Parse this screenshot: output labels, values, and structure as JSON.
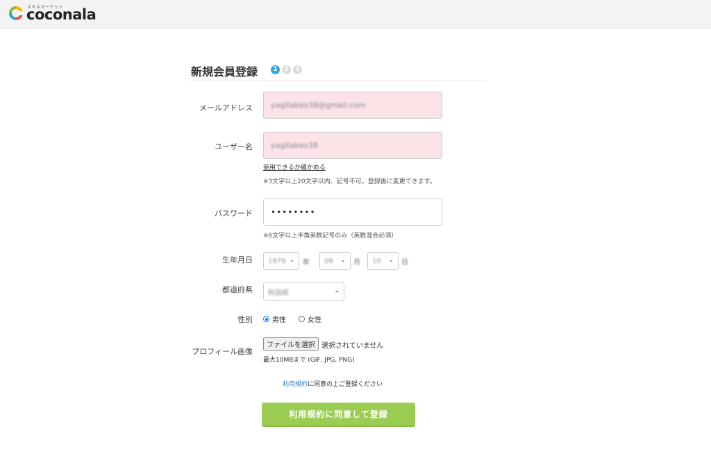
{
  "header": {
    "logo_tagline": "スキルマーケット",
    "logo_text": "coconala"
  },
  "form": {
    "title": "新規会員登録",
    "steps": [
      "1",
      "2",
      "3"
    ],
    "email": {
      "label": "メールアドレス",
      "value": "yagitakeo38@gmail.com"
    },
    "username": {
      "label": "ユーザー名",
      "value": "yagitakeo38",
      "check_link": "使用できるか確かめる",
      "note": "※3文字以上20文字以内、記号不可。登録後に変更できます。"
    },
    "password": {
      "label": "パスワード",
      "value": "••••••••",
      "note": "※6文字以上半角英数記号のみ（英数混合必須）"
    },
    "birthday": {
      "label": "生年月日",
      "year": "1979",
      "year_unit": "年",
      "month": "09",
      "month_unit": "月",
      "day": "10",
      "day_unit": "日"
    },
    "prefecture": {
      "label": "都道府県",
      "value": "秋田県"
    },
    "gender": {
      "label": "性別",
      "male": "男性",
      "female": "女性",
      "selected": "男性"
    },
    "profile_image": {
      "label": "プロフィール画像",
      "button": "ファイルを選択",
      "status": "選択されていません",
      "note": "最大10MBまで (GIF, JPG, PNG)"
    },
    "terms": {
      "link": "利用規約",
      "text": "に同意の上ご登録ください"
    },
    "submit": "利用規約に同意して登録"
  },
  "colors": {
    "step_active": "#2ea7e0",
    "input_highlight": "#fbe3e8",
    "submit_button": "#9acd52",
    "link": "#2a7fc1"
  }
}
